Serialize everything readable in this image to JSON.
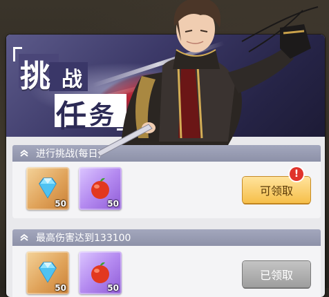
{
  "banner": {
    "title_chars": [
      "挑",
      "战",
      "任",
      "务"
    ]
  },
  "tasks": [
    {
      "title": "进行挑战(每日)",
      "rewards": [
        {
          "icon": "diamond-icon",
          "qty": "50"
        },
        {
          "icon": "apple-icon",
          "qty": "50"
        }
      ],
      "button_label": "可领取",
      "button_state": "claimable",
      "badge": "!"
    },
    {
      "title": "最高伤害达到133100",
      "rewards": [
        {
          "icon": "diamond-icon",
          "qty": "50"
        },
        {
          "icon": "apple-icon",
          "qty": "50"
        }
      ],
      "button_label": "已领取",
      "button_state": "claimed"
    }
  ],
  "colors": {
    "claim_active": "#f6bf4a",
    "claim_done": "#9e9e9e",
    "header_bar": "#8d91a8",
    "badge": "#e0342c"
  }
}
